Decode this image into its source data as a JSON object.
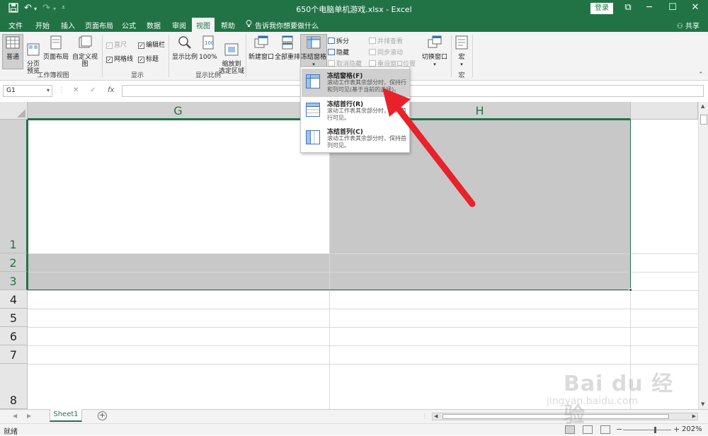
{
  "window": {
    "title": "650个电脑单机游戏.xlsx  -  Excel",
    "login_label": "登录",
    "controls": {
      "restore": "⧉",
      "minimize": "─",
      "maximize": "☐",
      "close": "✕"
    }
  },
  "quick_access": {
    "save_icon": "save-icon",
    "undo_icon": "undo-icon",
    "redo_icon": "redo-icon"
  },
  "tabs": [
    "文件",
    "开始",
    "插入",
    "页面布局",
    "公式",
    "数据",
    "审阅",
    "视图",
    "帮助"
  ],
  "active_tab": "视图",
  "tell_me": "告诉我你想要做什么",
  "share_label": "共享",
  "ribbon": {
    "workbook_views": {
      "group_label": "工作簿视图",
      "normal": "普通",
      "page_break": "分页\n预览",
      "page_layout": "页面布局",
      "custom_view": "自定义视图"
    },
    "show": {
      "group_label": "显示",
      "ruler": "直尺",
      "formula_bar": "编辑栏",
      "gridlines": "网格线",
      "headings": "标题"
    },
    "zoom": {
      "group_label": "显示比例",
      "zoom": "显示比例",
      "hundred": "100%",
      "zoom_to_selection": "缩放到\n选定区域"
    },
    "window": {
      "new_window": "新建窗口",
      "arrange_all": "全部重排",
      "freeze_panes": "冻结窗格",
      "split": "拆分",
      "hide": "隐藏",
      "unhide": "取消隐藏",
      "view_side_by_side": "并排查看",
      "sync_scroll": "同步滚动",
      "reset_position": "重设窗口位置",
      "switch_windows": "切换窗口"
    },
    "macros": {
      "group_label": "宏",
      "macros": "宏"
    }
  },
  "formula_bar": {
    "name_box": "G1",
    "cancel": "✕",
    "enter": "✓",
    "fx": "fx",
    "value": ""
  },
  "grid": {
    "columns": [
      "G",
      "H"
    ],
    "rows": [
      "1",
      "2",
      "3",
      "4",
      "5",
      "6",
      "7",
      "8"
    ]
  },
  "freeze_menu": {
    "items": [
      {
        "title": "冻结窗格(F)",
        "desc": "滚动工作表其余部分时，保持行和列可见(基于当前的选择)。"
      },
      {
        "title": "冻结首行(R)",
        "desc": "滚动工作表其余部分时，保持首行可见。"
      },
      {
        "title": "冻结首列(C)",
        "desc": "滚动工作表其余部分时，保持首列可见。"
      }
    ]
  },
  "sheets": {
    "tabs": [
      "Sheet1"
    ],
    "add_icon": "+"
  },
  "status": {
    "ready": "就绪",
    "zoom": "202%",
    "zoom_out": "−",
    "zoom_in": "+"
  },
  "watermark": {
    "brand": "Bai du 经验",
    "url": "jingyan.baidu.com"
  },
  "colors": {
    "excel_green": "#217346",
    "selection_fill": "#c8c8c8",
    "arrow_red": "#e8222b"
  }
}
